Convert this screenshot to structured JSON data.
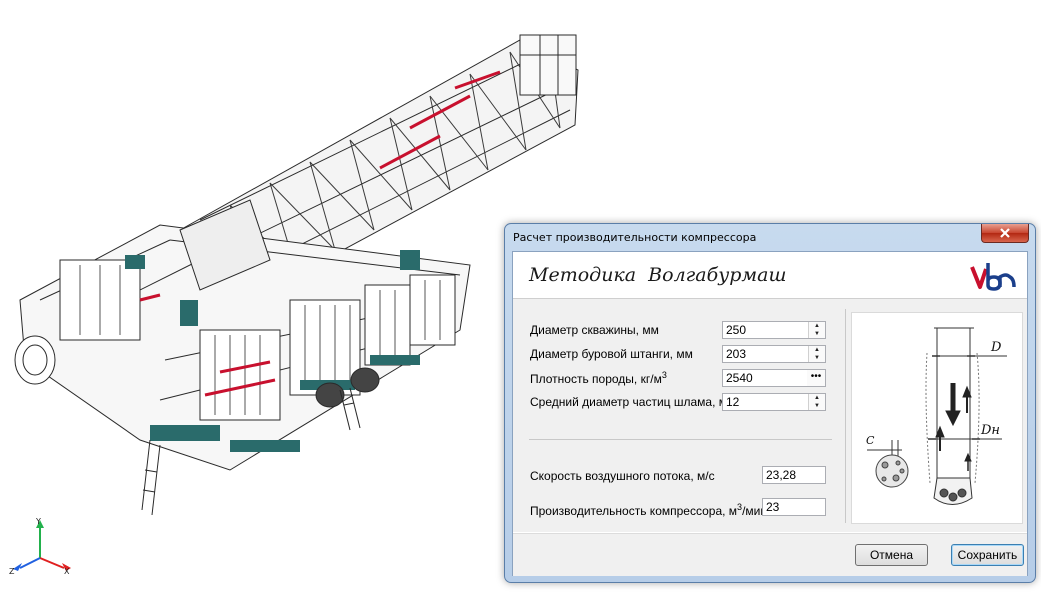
{
  "dialog": {
    "title": "Расчет производительности компрессора",
    "header_title": "Методика  Волгабурмаш",
    "fields": [
      {
        "label": "Диаметр скважины, мм",
        "value": "250"
      },
      {
        "label": "Диаметр буровой штанги, мм",
        "value": "203"
      },
      {
        "label": "Плотность породы, кг/м",
        "sup": "3",
        "value": "2540"
      },
      {
        "label": "Средний диаметр частиц шлама, мм",
        "value": "12"
      }
    ],
    "results": [
      {
        "label": "Скорость воздушного потока, м/с",
        "value": "23,28"
      },
      {
        "label": "Производительность компрессора, м",
        "sup": "3",
        "suffix": "/мин",
        "value": "23"
      }
    ],
    "diagram_labels": {
      "d": "D",
      "c": "C",
      "dh": "Dн"
    },
    "cancel_label": "Отмена",
    "save_label": "Сохранить"
  },
  "triad": {
    "x": "X",
    "y": "Y",
    "z": "Z"
  },
  "colors": {
    "accent_red": "#c8102e",
    "logo_blue": "#1b3f8b",
    "rig_teal": "#2a6b6b"
  }
}
